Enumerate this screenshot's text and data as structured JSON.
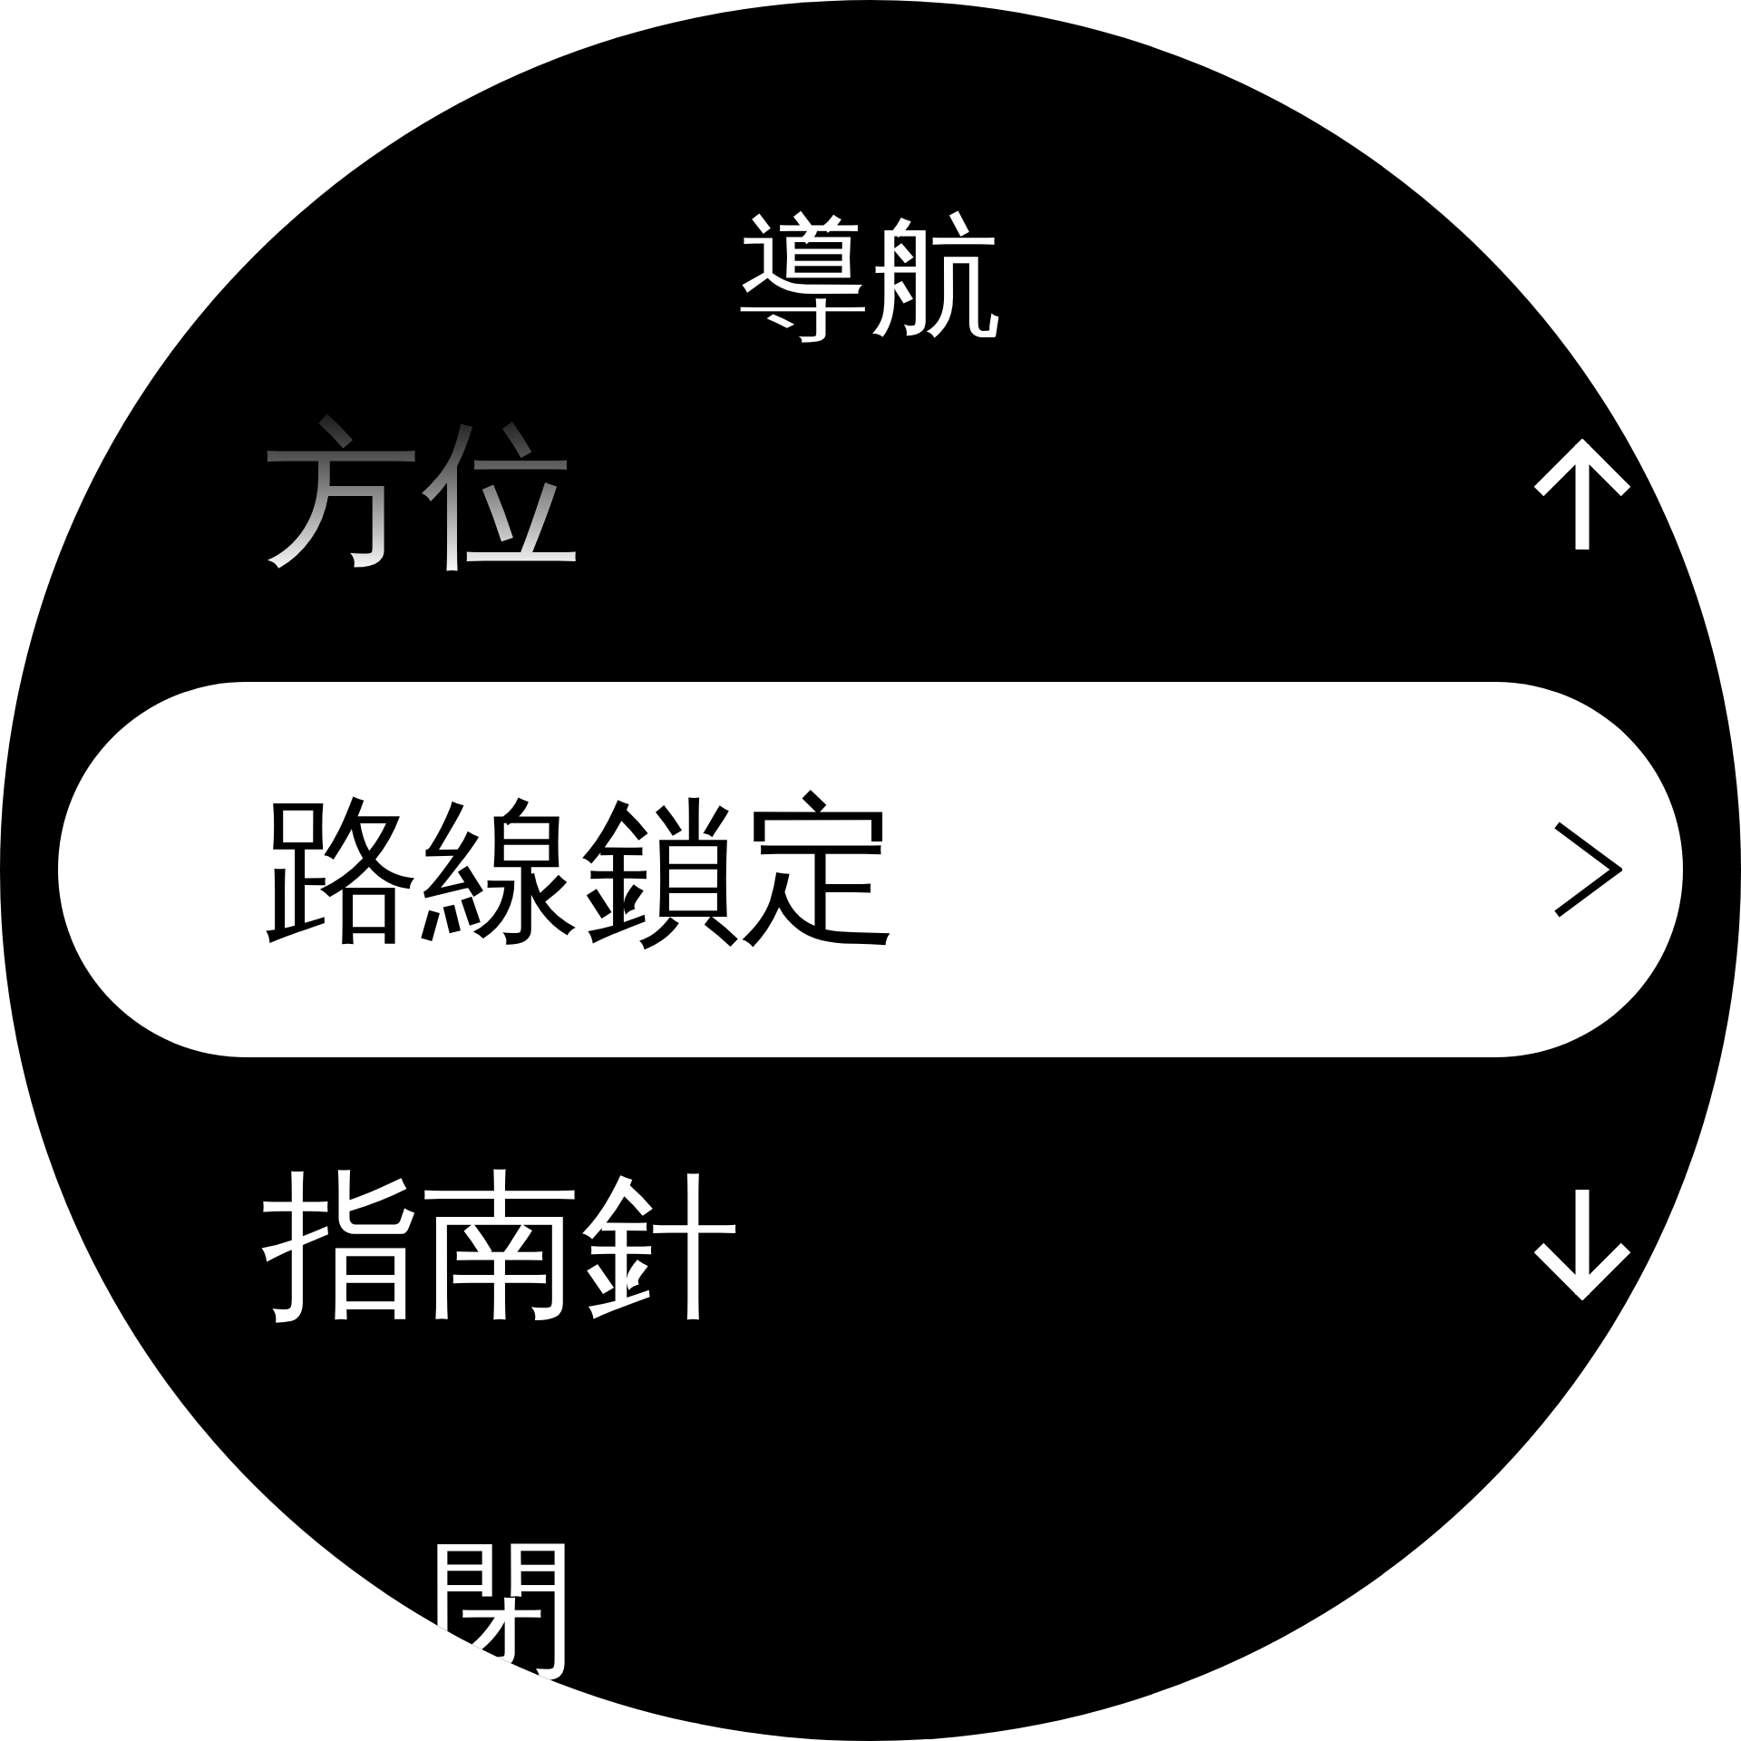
{
  "title": "導航",
  "items": [
    {
      "label": "方位",
      "selected": false
    },
    {
      "label": "路線鎖定",
      "selected": true
    },
    {
      "label": "指南針",
      "selected": false
    },
    {
      "label": "閉",
      "selected": false
    }
  ]
}
